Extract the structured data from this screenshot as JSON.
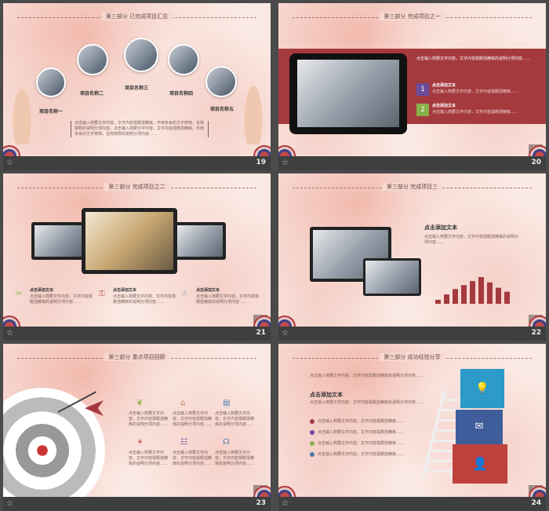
{
  "slides": [
    {
      "num": "19",
      "title": "第三部分  已完成项目汇总",
      "labels": [
        "项目名称一",
        "项目名称二",
        "项目名称三",
        "项目名称四",
        "项目名称五"
      ],
      "body": "点击输入简要文字内容，文字内容需概括精炼，不用多余的文字修饰，言简意赅的说明分项内容。点击输入简要文字内容，文字内容需概括精炼，不用多余的文字修饰，言简意赅的说明分项内容……"
    },
    {
      "num": "20",
      "title": "第三部分  完成项目之一",
      "page": "20",
      "intro": "点击输入简要文字内容，文字内容需概括精炼的说明分项内容……",
      "items": [
        {
          "n": "1",
          "head": "点击添加文本",
          "text": "点击输入简要文字内容，文字内容需概括精炼……"
        },
        {
          "n": "2",
          "head": "点击添加文本",
          "text": "点击输入简要文字内容，文字内容需概括精炼……"
        }
      ]
    },
    {
      "num": "21",
      "title": "第三部分  完成项目之二",
      "page": "21",
      "items": [
        {
          "head": "点击添加文本",
          "text": "点击输入简要文字内容，文字内容需概括精炼的说明分项内容……"
        },
        {
          "head": "点击添加文本",
          "text": "点击输入简要文字内容，文字内容需概括精炼的说明分项内容……"
        },
        {
          "head": "点击添加文本",
          "text": "点击输入简要文字内容，文字内容需概括精炼的说明分项内容……"
        }
      ]
    },
    {
      "num": "22",
      "title": "第三部分  完成项目三",
      "page": "22",
      "head": "点击添加文本",
      "text": "点击输入简要文字内容，文字内容需概括精炼的说明分项内容……"
    },
    {
      "num": "23",
      "title": "第三部分  重点项目回顾",
      "page": "23",
      "items": [
        "点击输入简要文字内容，文字内容需概括精炼的说明分项内容……",
        "点击输入简要文字内容，文字内容需概括精炼的说明分项内容……",
        "点击输入简要文字内容，文字内容需概括精炼的说明分项内容……",
        "点击输入简要文字内容，文字内容需概括精炼的说明分项内容……",
        "点击输入简要文字内容，文字内容需概括精炼的说明分项内容……",
        "点击输入简要文字内容，文字内容需概括精炼的说明分项内容……"
      ]
    },
    {
      "num": "24",
      "title": "第三部分  成功经验分享",
      "page": "24",
      "intro": "点击输入简要文字内容，文字内容需概括精炼的说明分项内容……",
      "head": "点击添加文本",
      "text": "点击输入简要文字内容，文字内容需概括精炼的说明分项内容……",
      "bullets": [
        "点击输入简要文字内容，文字内容需概括精炼……",
        "点击输入简要文字内容，文字内容需概括精炼……",
        "点击输入简要文字内容，文字内容需概括精炼……",
        "点击输入简要文字内容，文字内容需概括精炼……"
      ]
    }
  ],
  "bar_icon": "star-icon",
  "colors": {
    "accent": "#a53a3e",
    "purple": "#6a4c9c",
    "green": "#8ab04a",
    "bar": "#3f3f3f"
  },
  "chart_bars": [
    0.15,
    0.35,
    0.55,
    0.7,
    0.85,
    1.0,
    0.8,
    0.6,
    0.45
  ]
}
